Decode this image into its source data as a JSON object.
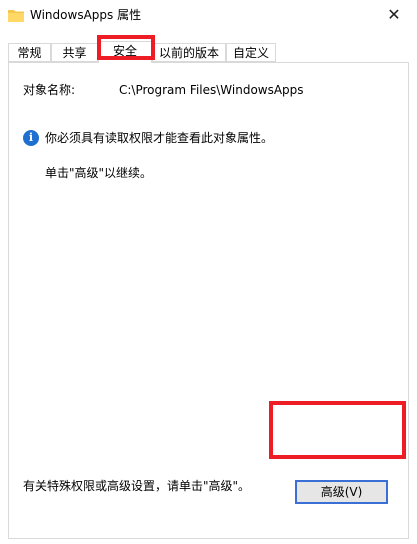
{
  "window": {
    "title": "WindowsApps 属性",
    "icon": "folder-icon",
    "close_glyph": "✕"
  },
  "tabs": [
    {
      "label": "常规"
    },
    {
      "label": "共享"
    },
    {
      "label": "安全",
      "selected": true
    },
    {
      "label": "以前的版本"
    },
    {
      "label": "自定义"
    }
  ],
  "security": {
    "object_name_label": "对象名称:",
    "object_name_value": "C:\\Program Files\\WindowsApps",
    "info_icon_glyph": "i",
    "info_text": "你必须具有读取权限才能查看此对象属性。",
    "continue_text": "单击\"高级\"以继续。",
    "special_text": "有关特殊权限或高级设置，请单击\"高级\"。",
    "advanced_button_label": "高级(V)"
  },
  "colors": {
    "highlight": "#ee1c25",
    "info_blue": "#1e6fcf",
    "folder_yellow": "#f5c84c",
    "button_focus": "#3a6fd8"
  }
}
